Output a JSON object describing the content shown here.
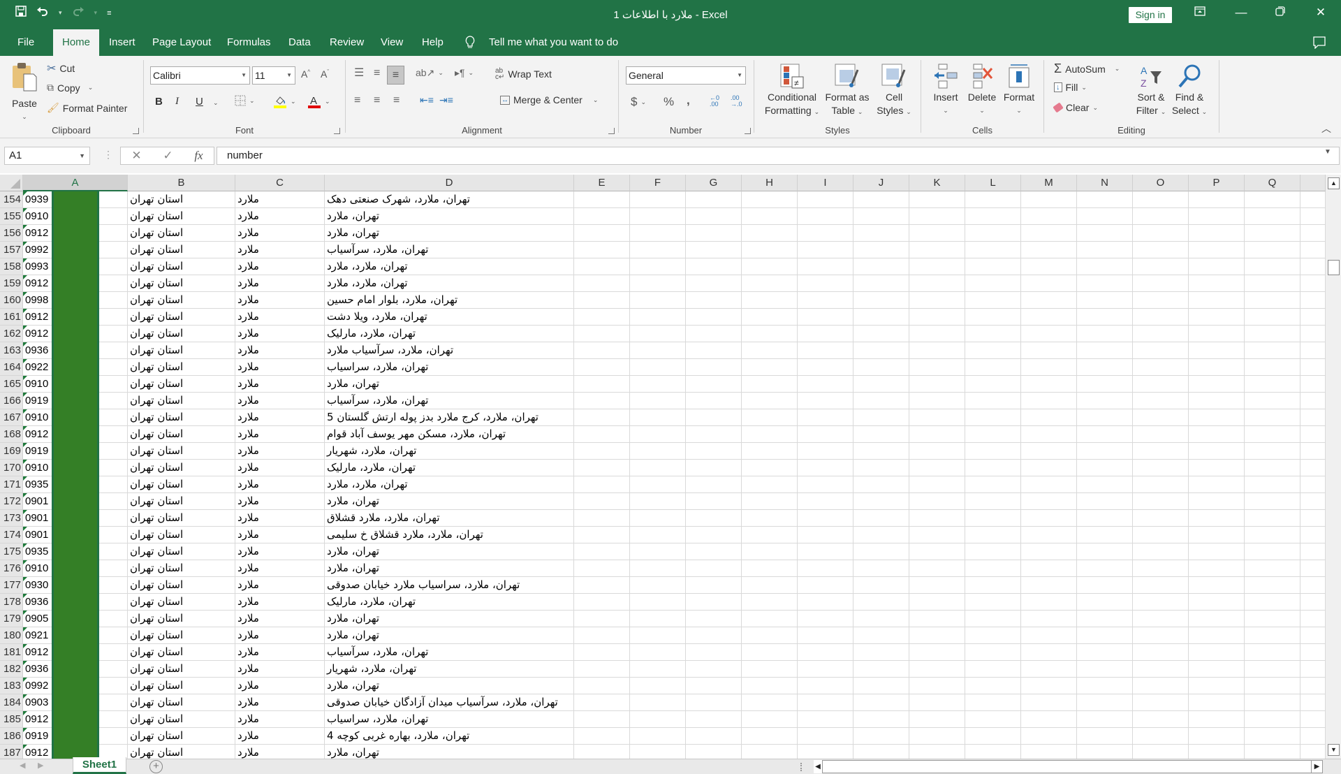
{
  "titlebar": {
    "title": "ملارد با اطلاعات 1  -  Excel",
    "sign_in": "Sign in",
    "icons": [
      "save-icon",
      "undo-icon",
      "redo-icon",
      "customize-qat-icon",
      "ribbon-display-options-icon",
      "minimize-icon",
      "restore-icon",
      "close-icon"
    ]
  },
  "tabs": [
    {
      "label": "File"
    },
    {
      "label": "Home",
      "active": true
    },
    {
      "label": "Insert"
    },
    {
      "label": "Page Layout"
    },
    {
      "label": "Formulas"
    },
    {
      "label": "Data"
    },
    {
      "label": "Review"
    },
    {
      "label": "View"
    },
    {
      "label": "Help"
    }
  ],
  "tell_me": "Tell me what you want to do",
  "ribbon": {
    "clipboard": {
      "label": "Clipboard",
      "paste": "Paste",
      "cut": "Cut",
      "copy": "Copy",
      "format_painter": "Format Painter"
    },
    "font": {
      "label": "Font",
      "font_name": "Calibri",
      "font_size": "11",
      "bold": "B",
      "italic": "I",
      "underline": "U",
      "highlight_color": "#ffff00",
      "font_color": "#e00000"
    },
    "alignment": {
      "label": "Alignment",
      "wrap_text": "Wrap Text",
      "merge_center": "Merge & Center"
    },
    "number": {
      "label": "Number",
      "format": "General",
      "currency": "$",
      "percent": "%",
      "comma": ","
    },
    "styles": {
      "label": "Styles",
      "conditional_1": "Conditional",
      "conditional_2": "Formatting",
      "format_table_1": "Format as",
      "format_table_2": "Table",
      "cell_styles_1": "Cell",
      "cell_styles_2": "Styles"
    },
    "cells": {
      "label": "Cells",
      "insert": "Insert",
      "delete": "Delete",
      "format": "Format"
    },
    "editing": {
      "label": "Editing",
      "autosum": "AutoSum",
      "fill": "Fill",
      "clear": "Clear",
      "sort_1": "Sort &",
      "sort_2": "Filter",
      "find_1": "Find &",
      "find_2": "Select"
    }
  },
  "formula_bar": {
    "name_box": "A1",
    "content": "number",
    "fx": "fx"
  },
  "columns": [
    "A",
    "B",
    "C",
    "D",
    "E",
    "F",
    "G",
    "H",
    "I",
    "J",
    "K",
    "L",
    "M",
    "N",
    "O",
    "P",
    "Q"
  ],
  "selected_column": "A",
  "rows": [
    {
      "n": "154",
      "a": "0939",
      "b": "استان تهران",
      "c": "ملارد",
      "d": "تهران، ملارد، شهرک صنعتی دهک"
    },
    {
      "n": "155",
      "a": "0910",
      "b": "استان تهران",
      "c": "ملارد",
      "d": "تهران، ملارد"
    },
    {
      "n": "156",
      "a": "0912",
      "b": "استان تهران",
      "c": "ملارد",
      "d": "تهران، ملارد"
    },
    {
      "n": "157",
      "a": "0992",
      "b": "استان تهران",
      "c": "ملارد",
      "d": "تهران، ملارد، سرآسیاب"
    },
    {
      "n": "158",
      "a": "0993",
      "b": "استان تهران",
      "c": "ملارد",
      "d": "تهران، ملارد، ملارد"
    },
    {
      "n": "159",
      "a": "0912",
      "b": "استان تهران",
      "c": "ملارد",
      "d": "تهران، ملارد، ملارد"
    },
    {
      "n": "160",
      "a": "0998",
      "b": "استان تهران",
      "c": "ملارد",
      "d": "تهران، ملارد، بلوار امام حسین"
    },
    {
      "n": "161",
      "a": "0912",
      "b": "استان تهران",
      "c": "ملارد",
      "d": "تهران، ملارد، ویلا دشت"
    },
    {
      "n": "162",
      "a": "0912",
      "b": "استان تهران",
      "c": "ملارد",
      "d": "تهران، ملارد، مارلیک"
    },
    {
      "n": "163",
      "a": "0936",
      "b": "استان تهران",
      "c": "ملارد",
      "d": "تهران، ملارد، سرآسیاب ملارد"
    },
    {
      "n": "164",
      "a": "0922",
      "b": "استان تهران",
      "c": "ملارد",
      "d": "تهران، ملارد، سراسیاب"
    },
    {
      "n": "165",
      "a": "0910",
      "b": "استان تهران",
      "c": "ملارد",
      "d": "تهران، ملارد"
    },
    {
      "n": "166",
      "a": "0919",
      "b": "استان تهران",
      "c": "ملارد",
      "d": "تهران، ملارد، سرآسیاب"
    },
    {
      "n": "167",
      "a": "0910",
      "b": "استان تهران",
      "c": "ملارد",
      "d": "تهران، ملارد، کرج ملارد بدز پوله ارتش گلستان 5"
    },
    {
      "n": "168",
      "a": "0912",
      "b": "استان تهران",
      "c": "ملارد",
      "d": "تهران، ملارد، مسکن مهر یوسف آباد قوام"
    },
    {
      "n": "169",
      "a": "0919",
      "b": "استان تهران",
      "c": "ملارد",
      "d": "تهران، ملارد، شهریار"
    },
    {
      "n": "170",
      "a": "0910",
      "b": "استان تهران",
      "c": "ملارد",
      "d": "تهران، ملارد، مارلیک"
    },
    {
      "n": "171",
      "a": "0935",
      "b": "استان تهران",
      "c": "ملارد",
      "d": "تهران، ملارد، ملارد"
    },
    {
      "n": "172",
      "a": "0901",
      "b": "استان تهران",
      "c": "ملارد",
      "d": "تهران، ملارد"
    },
    {
      "n": "173",
      "a": "0901",
      "b": "استان تهران",
      "c": "ملارد",
      "d": "تهران، ملارد، ملارد قشلاق"
    },
    {
      "n": "174",
      "a": "0901",
      "b": "استان تهران",
      "c": "ملارد",
      "d": "تهران، ملارد، ملارد قشلاق خ سلیمی"
    },
    {
      "n": "175",
      "a": "0935",
      "b": "استان تهران",
      "c": "ملارد",
      "d": "تهران، ملارد"
    },
    {
      "n": "176",
      "a": "0910",
      "b": "استان تهران",
      "c": "ملارد",
      "d": "تهران، ملارد"
    },
    {
      "n": "177",
      "a": "0930",
      "b": "استان تهران",
      "c": "ملارد",
      "d": "تهران، ملارد، سراسیاب ملارد خیابان صدوقی"
    },
    {
      "n": "178",
      "a": "0936",
      "b": "استان تهران",
      "c": "ملارد",
      "d": "تهران، ملارد، مارلیک"
    },
    {
      "n": "179",
      "a": "0905",
      "b": "استان تهران",
      "c": "ملارد",
      "d": "تهران، ملارد"
    },
    {
      "n": "180",
      "a": "0921",
      "b": "استان تهران",
      "c": "ملارد",
      "d": "تهران، ملارد"
    },
    {
      "n": "181",
      "a": "0912",
      "b": "استان تهران",
      "c": "ملارد",
      "d": "تهران، ملارد، سرآسیاب"
    },
    {
      "n": "182",
      "a": "0936",
      "b": "استان تهران",
      "c": "ملارد",
      "d": "تهران، ملارد، شهریار"
    },
    {
      "n": "183",
      "a": "0992",
      "b": "استان تهران",
      "c": "ملارد",
      "d": "تهران، ملارد"
    },
    {
      "n": "184",
      "a": "0903",
      "b": "استان تهران",
      "c": "ملارد",
      "d": "تهران، ملارد، سرآسیاب میدان آزادگان خیابان صدوقی"
    },
    {
      "n": "185",
      "a": "0912",
      "b": "استان تهران",
      "c": "ملارد",
      "d": "تهران، ملارد، سراسیاب"
    },
    {
      "n": "186",
      "a": "0919",
      "b": "استان تهران",
      "c": "ملارد",
      "d": "تهران، ملارد، بهاره غربی کوچه 4"
    },
    {
      "n": "187",
      "a": "0912",
      "b": "استان تهران",
      "c": "ملارد",
      "d": "تهران، ملارد"
    }
  ],
  "sheets": [
    {
      "label": "Sheet1",
      "active": true
    }
  ],
  "add_sheet": "+",
  "redaction_color": "#347f26",
  "accent_color": "#217346"
}
